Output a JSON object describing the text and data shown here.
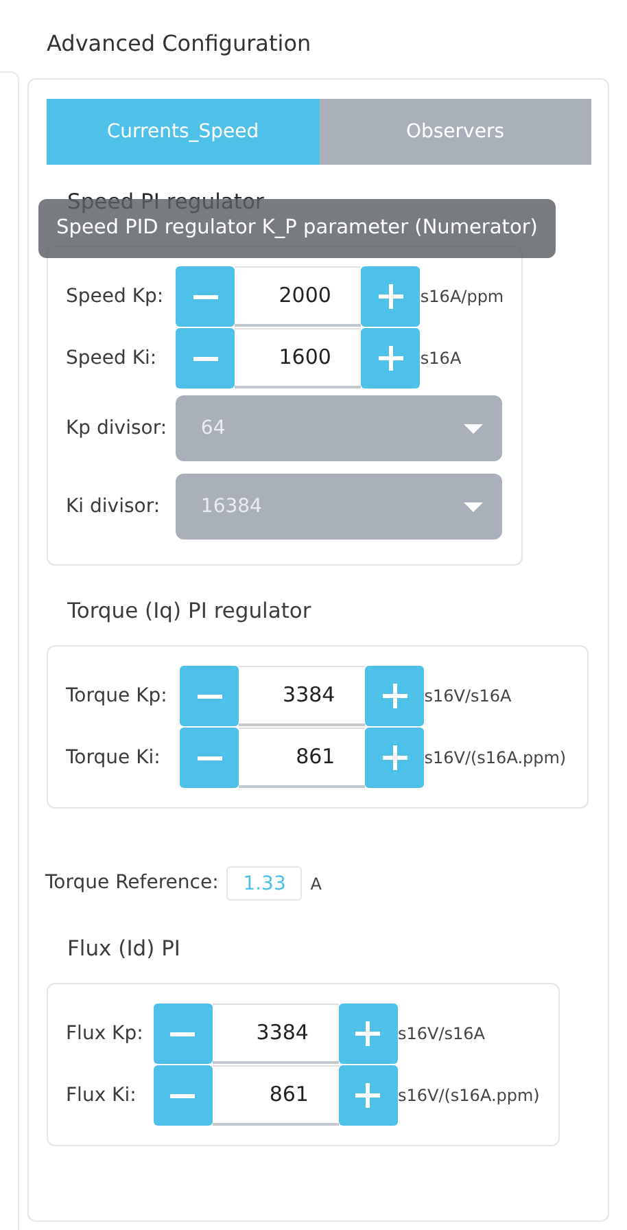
{
  "title": "Advanced Configuration",
  "tabs": [
    {
      "label": "Currents_Speed",
      "selected": true
    },
    {
      "label": "Observers",
      "selected": false
    }
  ],
  "tooltip": "Speed PID regulator K_P parameter (Numerator)",
  "sections": [
    {
      "kind": "group",
      "heading": "Speed PI regulator",
      "params": [
        {
          "kind": "spinner",
          "label": "Speed Kp:",
          "value": "2000",
          "unit": "s16A/ppm"
        },
        {
          "kind": "spinner",
          "label": "Speed Ki:",
          "value": "1600",
          "unit": "s16A"
        },
        {
          "kind": "select",
          "label": "Kp divisor:",
          "value": "64"
        },
        {
          "kind": "select",
          "label": "Ki divisor:",
          "value": "16384"
        }
      ]
    },
    {
      "kind": "group",
      "heading": "Torque (Iq) PI regulator",
      "params": [
        {
          "kind": "spinner",
          "label": "Torque Kp:",
          "value": "3384",
          "unit": "s16V/s16A"
        },
        {
          "kind": "spinner",
          "label": "Torque Ki:",
          "value": "861",
          "unit": "s16V/(s16A.ppm)"
        }
      ]
    },
    {
      "kind": "field",
      "label": "Torque Reference:",
      "value": "1.33",
      "unit": "A"
    },
    {
      "kind": "group",
      "heading": "Flux (Id) PI",
      "params": [
        {
          "kind": "spinner",
          "label": "Flux Kp:",
          "value": "3384",
          "unit": "s16V/s16A"
        },
        {
          "kind": "spinner",
          "label": "Flux Ki:",
          "value": "861",
          "unit": "s16V/(s16A.ppm)"
        }
      ]
    }
  ]
}
